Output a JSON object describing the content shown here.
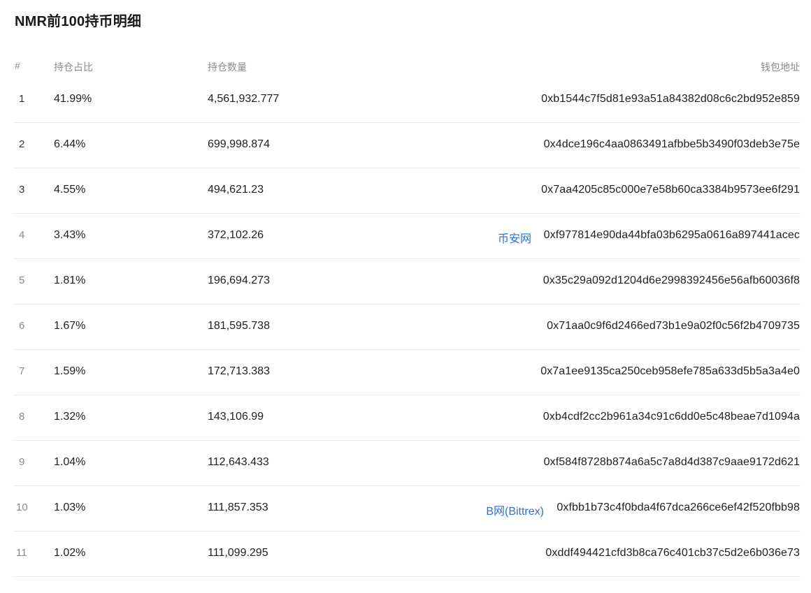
{
  "title": "NMR前100持币明细",
  "columns": {
    "rank": "#",
    "percent": "持仓占比",
    "quantity": "持仓数量",
    "address": "钱包地址"
  },
  "rows": [
    {
      "rank": "1",
      "percent": "41.99%",
      "quantity": "4,561,932.777",
      "tag": "",
      "address": "0xb1544c7f5d81e93a51a84382d08c6c2bd952e859"
    },
    {
      "rank": "2",
      "percent": "6.44%",
      "quantity": "699,998.874",
      "tag": "",
      "address": "0x4dce196c4aa0863491afbbe5b3490f03deb3e75e"
    },
    {
      "rank": "3",
      "percent": "4.55%",
      "quantity": "494,621.23",
      "tag": "",
      "address": "0x7aa4205c85c000e7e58b60ca3384b9573ee6f291"
    },
    {
      "rank": "4",
      "percent": "3.43%",
      "quantity": "372,102.26",
      "tag": "币安网",
      "address": "0xf977814e90da44bfa03b6295a0616a897441acec"
    },
    {
      "rank": "5",
      "percent": "1.81%",
      "quantity": "196,694.273",
      "tag": "",
      "address": "0x35c29a092d1204d6e2998392456e56afb60036f8"
    },
    {
      "rank": "6",
      "percent": "1.67%",
      "quantity": "181,595.738",
      "tag": "",
      "address": "0x71aa0c9f6d2466ed73b1e9a02f0c56f2b4709735"
    },
    {
      "rank": "7",
      "percent": "1.59%",
      "quantity": "172,713.383",
      "tag": "",
      "address": "0x7a1ee9135ca250ceb958efe785a633d5b5a3a4e0"
    },
    {
      "rank": "8",
      "percent": "1.32%",
      "quantity": "143,106.99",
      "tag": "",
      "address": "0xb4cdf2cc2b961a34c91c6dd0e5c48beae7d1094a"
    },
    {
      "rank": "9",
      "percent": "1.04%",
      "quantity": "112,643.433",
      "tag": "",
      "address": "0xf584f8728b874a6a5c7a8d4d387c9aae9172d621"
    },
    {
      "rank": "10",
      "percent": "1.03%",
      "quantity": "111,857.353",
      "tag": "B网(Bittrex)",
      "address": "0xfbb1b73c4f0bda4f67dca266ce6ef42f520fbb98"
    },
    {
      "rank": "11",
      "percent": "1.02%",
      "quantity": "111,099.295",
      "tag": "",
      "address": "0xddf494421cfd3b8ca76c401cb37c5d2e6b036e73"
    }
  ],
  "colors": {
    "text": "#1f1f1f",
    "header_text": "#8a8a8a",
    "link": "#2f6fd1",
    "divider": "#ececec"
  }
}
